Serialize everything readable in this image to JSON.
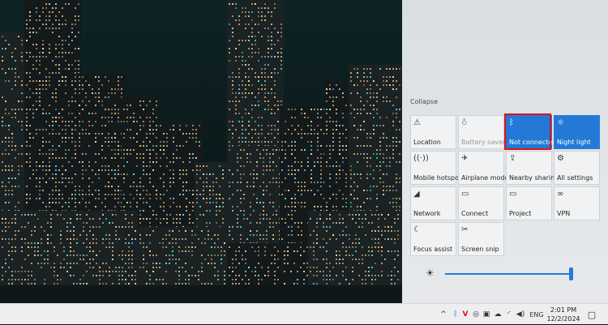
{
  "action_center": {
    "collapse_label": "Collapse",
    "tiles": [
      {
        "label": "Location",
        "icon": "location-icon",
        "glyph": "⚠",
        "state": "off"
      },
      {
        "label": "Battery saver",
        "icon": "battery-saver-icon",
        "glyph": "♁",
        "state": "disabled"
      },
      {
        "label": "Not connected",
        "icon": "bluetooth-icon",
        "glyph": "ᛒ",
        "state": "active"
      },
      {
        "label": "Night light",
        "icon": "night-light-icon",
        "glyph": "☼",
        "state": "active"
      },
      {
        "label": "Mobile hotspot",
        "icon": "mobile-hotspot-icon",
        "glyph": "((·))",
        "state": "off"
      },
      {
        "label": "Airplane mode",
        "icon": "airplane-icon",
        "glyph": "✈",
        "state": "off"
      },
      {
        "label": "Nearby sharing",
        "icon": "nearby-sharing-icon",
        "glyph": "⇪",
        "state": "off"
      },
      {
        "label": "All settings",
        "icon": "gear-icon",
        "glyph": "⚙",
        "state": "off"
      },
      {
        "label": "Network",
        "icon": "network-icon",
        "glyph": "◢",
        "state": "off"
      },
      {
        "label": "Connect",
        "icon": "connect-icon",
        "glyph": "▭",
        "state": "off"
      },
      {
        "label": "Project",
        "icon": "project-icon",
        "glyph": "▭",
        "state": "off"
      },
      {
        "label": "VPN",
        "icon": "vpn-icon",
        "glyph": "∞",
        "state": "off"
      },
      {
        "label": "Focus assist",
        "icon": "focus-assist-icon",
        "glyph": "☾",
        "state": "off"
      },
      {
        "label": "Screen snip",
        "icon": "screen-snip-icon",
        "glyph": "✂",
        "state": "off"
      }
    ],
    "brightness_icon": "☀",
    "brightness_level": 1.0
  },
  "taskbar": {
    "tray_icons": [
      {
        "name": "show-hidden-icons-chevron",
        "glyph": "^"
      },
      {
        "name": "bluetooth-tray-icon",
        "glyph": "ᛒ"
      },
      {
        "name": "antivirus-tray-icon",
        "glyph": "V"
      },
      {
        "name": "camera-tray-icon",
        "glyph": "◎"
      },
      {
        "name": "meet-now-tray-icon",
        "glyph": "▣"
      },
      {
        "name": "onedrive-tray-icon",
        "glyph": "☁"
      },
      {
        "name": "wifi-tray-icon",
        "glyph": "◜"
      },
      {
        "name": "volume-tray-icon",
        "glyph": "◀)"
      }
    ],
    "language": "ENG",
    "time": "2:01 PM",
    "date": "12/2/2024",
    "notification_glyph": "▢"
  },
  "colors": {
    "accent": "#2479d6",
    "highlight_box": "#e0121a"
  }
}
